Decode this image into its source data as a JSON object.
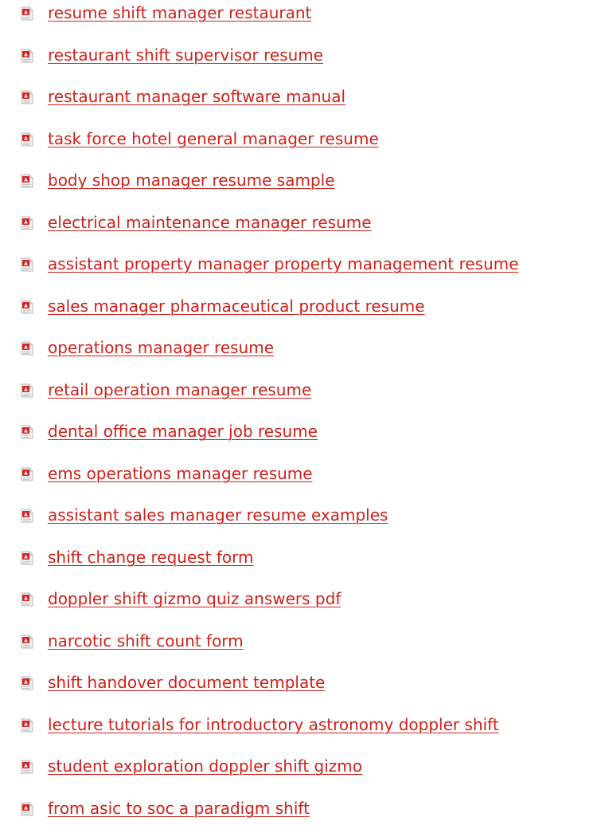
{
  "links": [
    {
      "label": "resume shift manager restaurant",
      "icon": "pdf-file-icon"
    },
    {
      "label": "restaurant shift supervisor resume",
      "icon": "pdf-file-icon"
    },
    {
      "label": "restaurant manager software manual",
      "icon": "pdf-file-icon"
    },
    {
      "label": "task force hotel general manager resume",
      "icon": "pdf-file-icon"
    },
    {
      "label": "body shop manager resume sample",
      "icon": "pdf-file-icon"
    },
    {
      "label": "electrical maintenance manager resume",
      "icon": "pdf-file-icon"
    },
    {
      "label": "assistant property manager property management resume",
      "icon": "pdf-file-icon"
    },
    {
      "label": "sales manager pharmaceutical product resume",
      "icon": "pdf-file-icon"
    },
    {
      "label": "operations manager resume",
      "icon": "pdf-file-icon"
    },
    {
      "label": "retail operation manager resume",
      "icon": "pdf-file-icon"
    },
    {
      "label": "dental office manager job resume",
      "icon": "pdf-file-icon"
    },
    {
      "label": "ems operations manager resume",
      "icon": "pdf-file-icon"
    },
    {
      "label": "assistant sales manager resume examples",
      "icon": "pdf-file-icon"
    },
    {
      "label": "shift change request form",
      "icon": "pdf-file-icon"
    },
    {
      "label": "doppler shift gizmo quiz answers pdf",
      "icon": "pdf-file-icon"
    },
    {
      "label": "narcotic shift count form",
      "icon": "pdf-file-icon"
    },
    {
      "label": "shift handover document template",
      "icon": "pdf-file-icon"
    },
    {
      "label": "lecture tutorials for introductory astronomy doppler shift",
      "icon": "pdf-file-icon"
    },
    {
      "label": "student exploration doppler shift gizmo",
      "icon": "pdf-file-icon"
    },
    {
      "label": "from asic to soc a paradigm shift",
      "icon": "pdf-file-icon"
    }
  ],
  "colors": {
    "link": "#d0201a",
    "icon_red": "#d42222",
    "icon_paper": "#f2f2f2",
    "background": "#ffffff"
  }
}
